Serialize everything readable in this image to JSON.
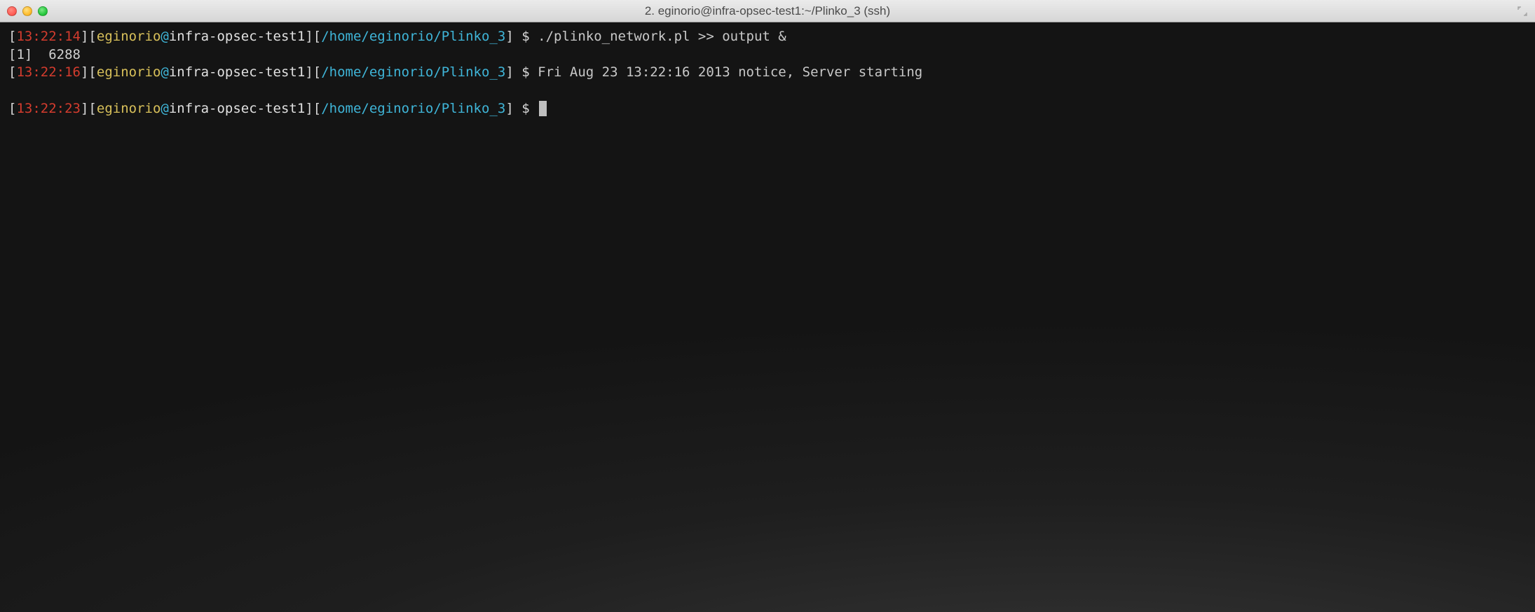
{
  "window": {
    "title": "2. eginorio@infra-opsec-test1:~/Plinko_3 (ssh)"
  },
  "prompt": {
    "user": "eginorio",
    "host": "infra-opsec-test1",
    "path": "/home/eginorio/Plinko_3",
    "dollar": "$"
  },
  "lines": [
    {
      "time": "13:22:14",
      "command": "./plinko_network.pl >> output &"
    },
    {
      "job_output": "[1]  6288"
    },
    {
      "time": "13:22:16",
      "after_prompt": "Fri Aug 23 13:22:16 2013 notice, Server starting"
    },
    {
      "blank": true
    },
    {
      "time": "13:22:23",
      "cursor": true
    }
  ],
  "brackets": {
    "open": "[",
    "close": "]"
  },
  "at": "@"
}
